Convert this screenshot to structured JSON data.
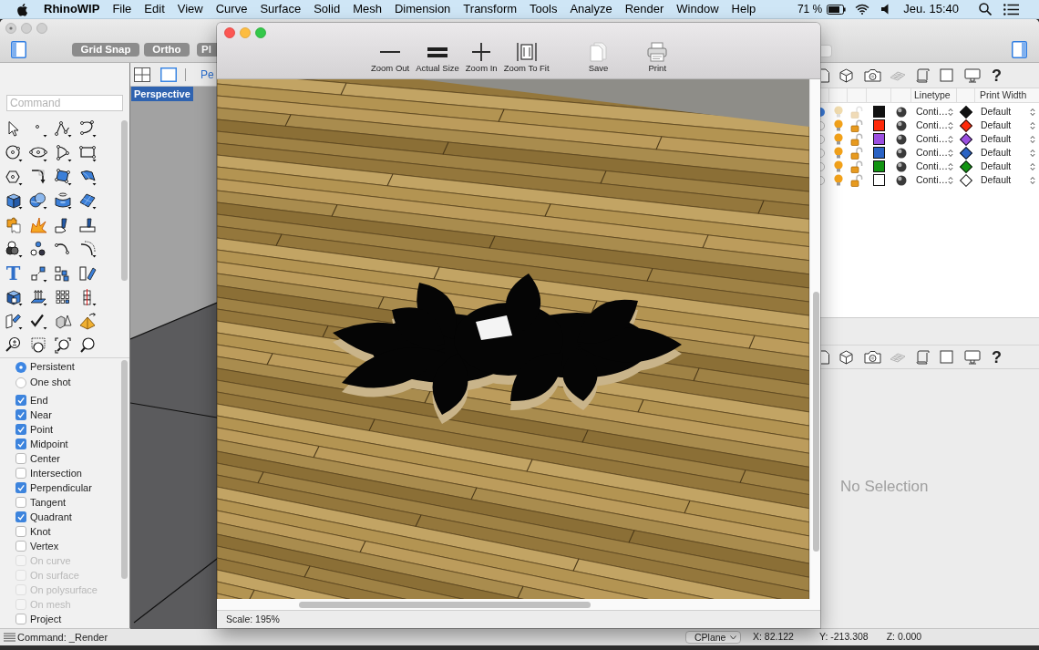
{
  "menu_bar": {
    "app_name": "RhinoWIP",
    "menus": [
      "File",
      "Edit",
      "View",
      "Curve",
      "Surface",
      "Solid",
      "Mesh",
      "Dimension",
      "Transform",
      "Tools",
      "Analyze",
      "Render",
      "Window",
      "Help"
    ],
    "battery": "71 %",
    "clock": "Jeu. 15:40"
  },
  "toolbar": {
    "buttons": [
      "Grid Snap",
      "Ortho",
      "Pl"
    ]
  },
  "command_field": {
    "placeholder": "Command"
  },
  "toolbox": {
    "text_tool": "T"
  },
  "viewport": {
    "tab": "Pe",
    "label": "Perspective"
  },
  "osnap": {
    "modes": [
      {
        "label": "Persistent",
        "selected": true
      },
      {
        "label": "One shot",
        "selected": false
      }
    ],
    "snaps": [
      {
        "label": "End",
        "checked": true,
        "disabled": false
      },
      {
        "label": "Near",
        "checked": true,
        "disabled": false
      },
      {
        "label": "Point",
        "checked": true,
        "disabled": false
      },
      {
        "label": "Midpoint",
        "checked": true,
        "disabled": false
      },
      {
        "label": "Center",
        "checked": false,
        "disabled": false
      },
      {
        "label": "Intersection",
        "checked": false,
        "disabled": false
      },
      {
        "label": "Perpendicular",
        "checked": true,
        "disabled": false
      },
      {
        "label": "Tangent",
        "checked": false,
        "disabled": false
      },
      {
        "label": "Quadrant",
        "checked": true,
        "disabled": false
      },
      {
        "label": "Knot",
        "checked": false,
        "disabled": false
      },
      {
        "label": "Vertex",
        "checked": false,
        "disabled": false
      },
      {
        "label": "On curve",
        "checked": false,
        "disabled": true
      },
      {
        "label": "On surface",
        "checked": false,
        "disabled": true
      },
      {
        "label": "On polysurface",
        "checked": false,
        "disabled": true
      },
      {
        "label": "On mesh",
        "checked": false,
        "disabled": true
      },
      {
        "label": "Project",
        "checked": false,
        "disabled": false
      }
    ]
  },
  "layers_panel": {
    "help": "?",
    "columns": [
      "Linetype",
      "Print Width"
    ],
    "rows": [
      {
        "current": true,
        "color": "#111111",
        "linetype": "Conti…",
        "print": {
          "color": "#111111",
          "width": "Default"
        }
      },
      {
        "current": false,
        "color": "#ff2a0a",
        "linetype": "Conti…",
        "print": {
          "color": "#ff2a0a",
          "width": "Default"
        }
      },
      {
        "current": false,
        "color": "#9b4fe0",
        "linetype": "Conti…",
        "print": {
          "color": "#9b4fe0",
          "width": "Default"
        }
      },
      {
        "current": false,
        "color": "#2a62c4",
        "linetype": "Conti…",
        "print": {
          "color": "#2a62c4",
          "width": "Default"
        }
      },
      {
        "current": false,
        "color": "#129412",
        "linetype": "Conti…",
        "print": {
          "color": "#129412",
          "width": "Default"
        }
      },
      {
        "current": false,
        "color": "#ffffff",
        "linetype": "Conti…",
        "print": {
          "color": "#ffffff",
          "width": "Default"
        }
      }
    ]
  },
  "properties_panel": {
    "help": "?",
    "message": "No Selection"
  },
  "status_bar": {
    "command": "Command: _Render",
    "cplane": "CPlane",
    "x": "X: 82.122",
    "y": "Y: -213.308",
    "z": "Z: 0.000"
  },
  "render_window": {
    "tools": [
      {
        "kind": "zoom-out",
        "label": "Zoom Out"
      },
      {
        "kind": "actual-size",
        "label": "Actual Size"
      },
      {
        "kind": "zoom-in",
        "label": "Zoom In"
      },
      {
        "kind": "zoom-to-fit",
        "label": "Zoom To Fit"
      },
      {
        "kind": "save",
        "label": "Save"
      },
      {
        "kind": "print",
        "label": "Print"
      }
    ],
    "scale": "Scale: 195%"
  }
}
